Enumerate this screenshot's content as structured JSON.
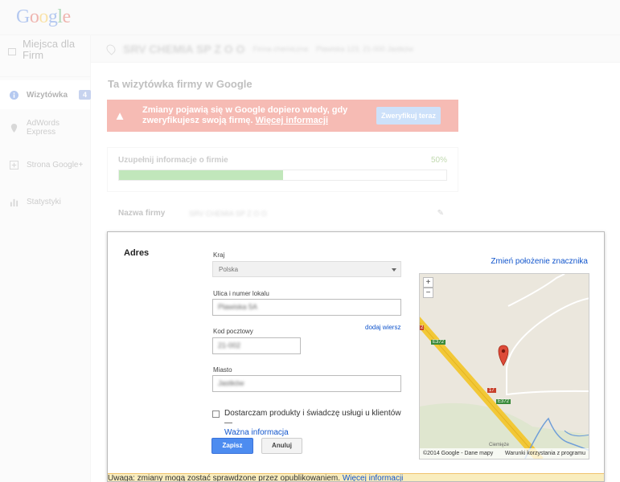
{
  "logo": {
    "letters": [
      "G",
      "o",
      "o",
      "g",
      "l",
      "e"
    ]
  },
  "sidebar": {
    "header": "Miejsca dla Firm",
    "items": [
      {
        "label": "Wizytówka",
        "badge": "4",
        "active": true,
        "icon": "info-icon"
      },
      {
        "label": "AdWords Express",
        "icon": "pin-icon"
      },
      {
        "label": "Strona Google+",
        "icon": "google-plus-icon"
      },
      {
        "label": "Statystyki",
        "icon": "stats-icon"
      }
    ]
  },
  "bizbar": {
    "name": "SRV CHEMIA SP Z O O",
    "type": "Firma chemiczna",
    "address": "Plawiska 123, 21-000 Jastków"
  },
  "main": {
    "title": "Ta wizytówka firmy w Google",
    "alert": {
      "text": "Zmiany pojawią się w Google dopiero wtedy, gdy zweryfikujesz swoją firmę.",
      "link": "Więcej informacji",
      "button": "Zweryfikuj teraz"
    },
    "progress": {
      "label": "Uzupełnij informacje o firmie",
      "percent_text": "50%",
      "value": 0.5
    },
    "name_row": {
      "label": "Nazwa firmy",
      "value": "SRV CHEMIA SP Z O O"
    }
  },
  "address_dialog": {
    "title": "Adres",
    "country_label": "Kraj",
    "country_value": "Polska",
    "street_label": "Ulica i numer lokalu",
    "street_value": "Plawiska 5A",
    "add_line_link": "dodaj wiersz",
    "postal_label": "Kod pocztowy",
    "postal_value": "21-002",
    "city_label": "Miasto",
    "city_value": "Jastków",
    "service_checkbox": "Dostarczam produkty i świadczę usługi u klientów —",
    "service_link": "Ważna informacja",
    "save": "Zapisz",
    "cancel": "Anuluj",
    "map_link": "Zmień położenie znacznika",
    "map": {
      "zoom_in": "+",
      "zoom_out": "−",
      "copyright": "©2014 Google - Dane mapy",
      "terms": "Warunki korzystania z programu",
      "road_labels": [
        "E372",
        "17",
        "E372",
        "2"
      ],
      "place_label": "Ciemięże"
    }
  },
  "footer": {
    "text": "Uwaga: zmiany mogą zostać sprawdzone przez opublikowaniem.",
    "link": "Więcej informacji"
  }
}
